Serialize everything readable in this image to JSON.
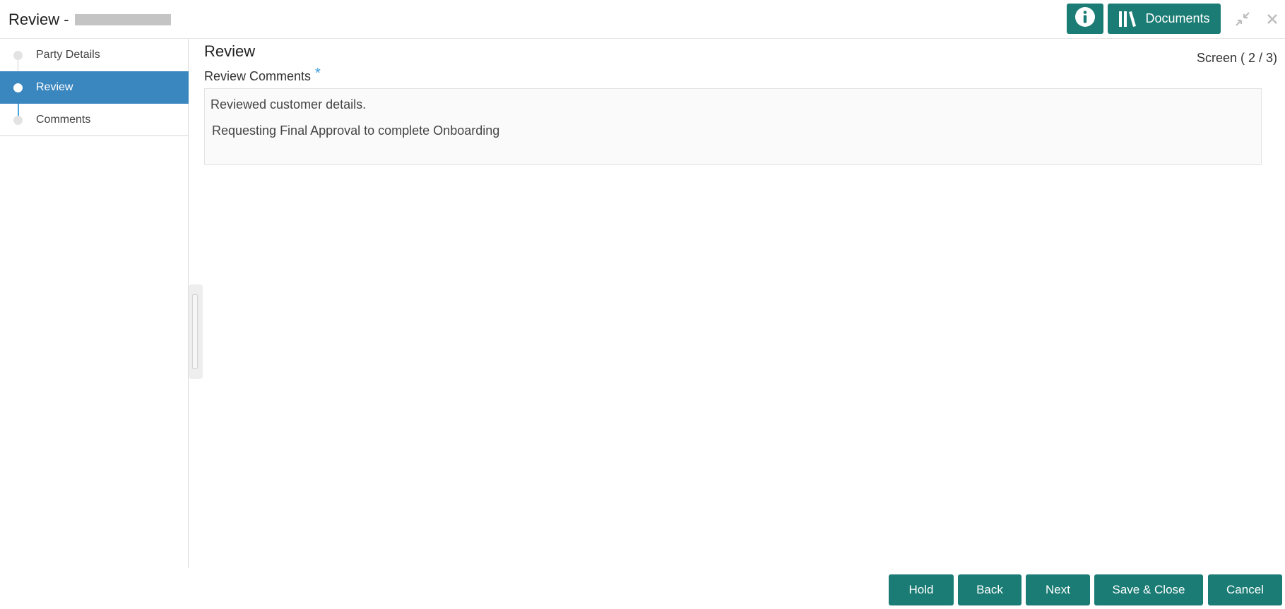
{
  "header": {
    "title": "Review -",
    "documents_label": "Documents",
    "info_icon": "info-icon",
    "documents_icon": "library-icon",
    "minimize_icon": "minimize-icon",
    "close_icon": "close-icon"
  },
  "sidebar": {
    "items": [
      {
        "label": "Party Details",
        "state": "completed"
      },
      {
        "label": "Review",
        "state": "active"
      },
      {
        "label": "Comments",
        "state": "pending"
      }
    ]
  },
  "main": {
    "title": "Review",
    "screen_counter": "Screen ( 2 / 3)",
    "field_label": "Review Comments",
    "required_mark": "*",
    "comments_line1": "Reviewed customer details.",
    "comments_line2": "Requesting Final Approval to complete Onboarding"
  },
  "footer": {
    "hold": "Hold",
    "back": "Back",
    "next": "Next",
    "save_close": "Save & Close",
    "cancel": "Cancel"
  },
  "colors": {
    "primary": "#1a7c74",
    "active_step": "#3a86bf",
    "required": "#3a9bd8"
  }
}
